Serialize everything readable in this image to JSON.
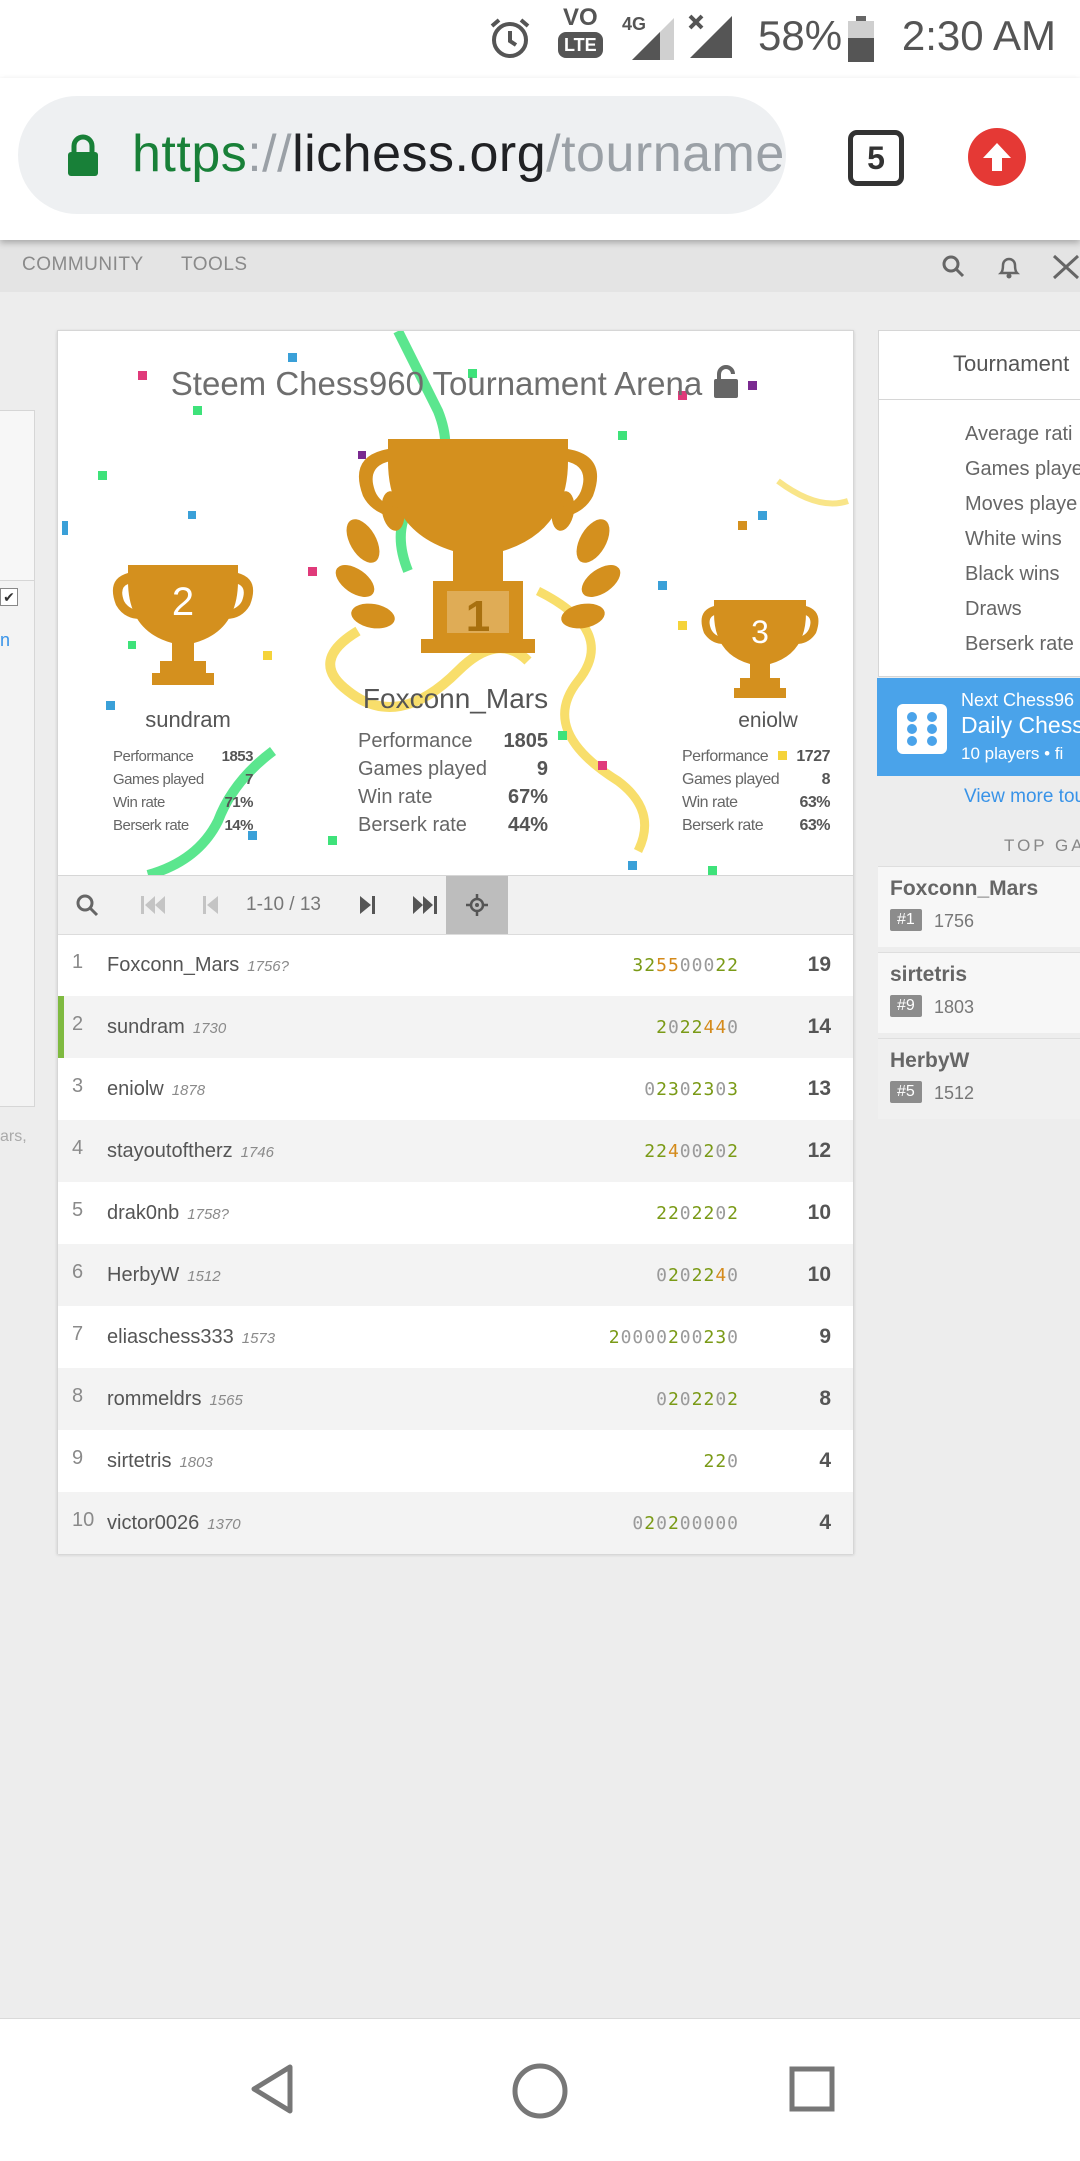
{
  "status_bar": {
    "time": "2:30 AM",
    "battery_pct": "58%",
    "volte": "VO",
    "lte": "LTE",
    "net": "4G",
    "icons": [
      "alarm-icon",
      "volte-icon",
      "signal-4g-icon",
      "signal-noservice-icon",
      "battery-icon"
    ]
  },
  "browser": {
    "url_scheme": "https",
    "url_sep": "://",
    "url_host": "lichess.org",
    "url_path": "/tournamen",
    "tab_count": "5"
  },
  "site_nav": {
    "items": [
      "COMMUNITY",
      "TOOLS"
    ]
  },
  "left_panel": {
    "link_fragment": "n",
    "text_fragment": "ars,"
  },
  "tournament": {
    "title": "Steem Chess960 Tournament Arena",
    "podium": [
      {
        "place": "1",
        "name": "Foxconn_Mars",
        "stats": [
          {
            "label": "Performance",
            "value": "1805"
          },
          {
            "label": "Games played",
            "value": "9"
          },
          {
            "label": "Win rate",
            "value": "67%"
          },
          {
            "label": "Berserk rate",
            "value": "44%"
          }
        ]
      },
      {
        "place": "2",
        "name": "sundram",
        "stats": [
          {
            "label": "Performance",
            "value": "1853"
          },
          {
            "label": "Games played",
            "value": "7"
          },
          {
            "label": "Win rate",
            "value": "71%"
          },
          {
            "label": "Berserk rate",
            "value": "14%"
          }
        ]
      },
      {
        "place": "3",
        "name": "eniolw",
        "stats": [
          {
            "label": "Performance",
            "value": "1727"
          },
          {
            "label": "Games played",
            "value": "8"
          },
          {
            "label": "Win rate",
            "value": "63%"
          },
          {
            "label": "Berserk rate",
            "value": "63%"
          }
        ]
      }
    ],
    "pager": {
      "info": "1-10 / 13"
    },
    "standings": [
      {
        "rank": "1",
        "name": "Foxconn_Mars",
        "rating": "1756?",
        "sheet": "325500022",
        "total": "19"
      },
      {
        "rank": "2",
        "name": "sundram",
        "rating": "1730",
        "sheet": "2022440",
        "total": "14"
      },
      {
        "rank": "3",
        "name": "eniolw",
        "rating": "1878",
        "sheet": "02302303",
        "total": "13"
      },
      {
        "rank": "4",
        "name": "stayoutoftherz",
        "rating": "1746",
        "sheet": "22400202",
        "total": "12"
      },
      {
        "rank": "5",
        "name": "drak0nb",
        "rating": "1758?",
        "sheet": "2202202",
        "total": "10"
      },
      {
        "rank": "6",
        "name": "HerbyW",
        "rating": "1512",
        "sheet": "0202240",
        "total": "10"
      },
      {
        "rank": "7",
        "name": "eliaschess333",
        "rating": "1573",
        "sheet": "20000200230",
        "total": "9"
      },
      {
        "rank": "8",
        "name": "rommeldrs",
        "rating": "1565",
        "sheet": "0202202",
        "total": "8"
      },
      {
        "rank": "9",
        "name": "sirtetris",
        "rating": "1803",
        "sheet": "220",
        "total": "4"
      },
      {
        "rank": "10",
        "name": "victor0026",
        "rating": "1370",
        "sheet": "020200000",
        "total": "4"
      }
    ]
  },
  "side": {
    "title": "Tournament",
    "stats": [
      "Average rati",
      "Games playe",
      "Moves playe",
      "White wins",
      "Black wins",
      "Draws",
      "Berserk rate"
    ],
    "next": {
      "line1": "Next Chess96",
      "line2": "Daily Chess",
      "line3": "10 players • fi"
    },
    "more_link": "View more tou",
    "top_games_label": "TOP GA",
    "top_games": [
      {
        "name": "Foxconn_Mars",
        "rank": "#1",
        "rating": "1756"
      },
      {
        "name": "sirtetris",
        "rank": "#9",
        "rating": "1803"
      },
      {
        "name": "HerbyW",
        "rank": "#5",
        "rating": "1512"
      }
    ]
  },
  "colors": {
    "trophy": "#d4901e",
    "accent_blue": "#4aa3ea",
    "win_green": "#7a9a16",
    "streak_orange": "#d48a1a",
    "url_green": "#188038",
    "update_red": "#e53935"
  }
}
